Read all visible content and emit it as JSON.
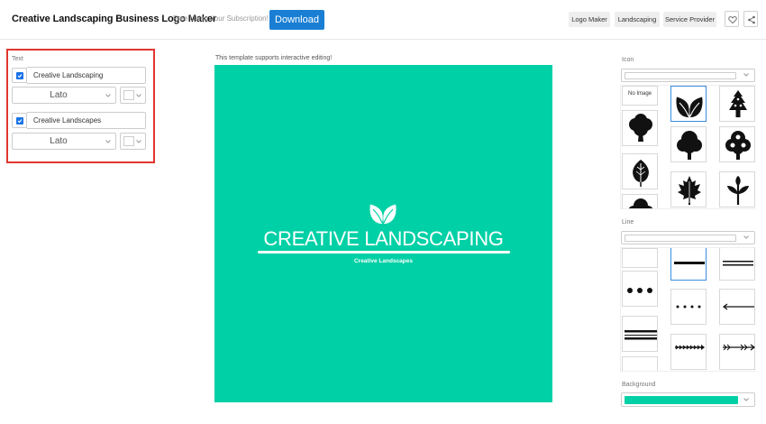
{
  "header": {
    "title": "Creative Landscaping Business Logo Maker",
    "subtitle": "Free Using Your Subscription!",
    "download_label": "Download",
    "tags": [
      "Logo Maker",
      "Landscaping",
      "Service Provider"
    ],
    "icons": [
      "heart-icon",
      "share-icon"
    ]
  },
  "text_panel": {
    "label": "Text",
    "entries": [
      {
        "checked": true,
        "value": "Creative Landscaping",
        "font": "Lato",
        "color": "#ffffff"
      },
      {
        "checked": true,
        "value": "Creative Landscapes",
        "font": "Lato",
        "color": "#ffffff"
      }
    ]
  },
  "canvas": {
    "note": "This template supports interactive editing!",
    "background": "#00d0a6",
    "logo": {
      "icon": "leaves-icon",
      "title": "CREATIVE LANDSCAPING",
      "subtitle": "Creative Landscapes",
      "text_color": "#ffffff"
    }
  },
  "right_panel": {
    "icon_label": "Icon",
    "icon_tiles": [
      "No Image",
      "leaf-pair-icon",
      "pine-tree-icon",
      "round-tree-icon",
      "bushy-tree-icon",
      "spotted-tree-icon",
      "leaf-icon",
      "maple-leaf-icon",
      "sprout-icon",
      "bush-icon",
      "blank",
      "blank"
    ],
    "selected_icon": "leaf-pair-icon",
    "line_label": "Line",
    "line_tiles": [
      "blank-line",
      "thick-line",
      "double-line",
      "big-dots-line",
      "small-dots-line",
      "arrow-line",
      "triple-line",
      "arrow-chevrons-line",
      "fletched-arrow-line",
      "blank-line",
      "blank-line",
      "blank-line"
    ],
    "selected_line": "thick-line",
    "background_label": "Background",
    "background_color": "#00d0a6"
  },
  "colors": {
    "accent": "#1a7fd4",
    "highlight_border": "#e0372f",
    "checkbox": "#1a73e8"
  }
}
